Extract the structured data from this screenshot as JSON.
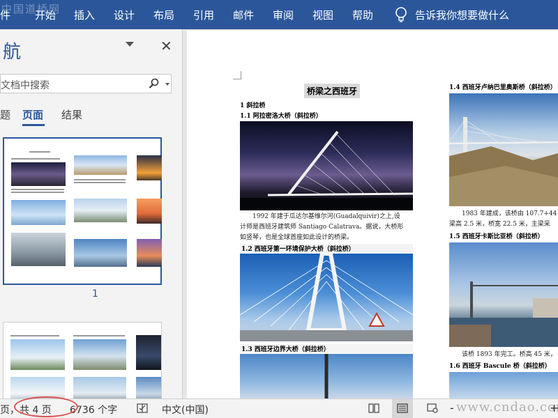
{
  "ribbon": {
    "watermark": "中国道桥网",
    "tabs": [
      "开始",
      "插入",
      "设计",
      "布局",
      "引用",
      "邮件",
      "审阅",
      "视图",
      "帮助"
    ],
    "first_tab_fragment": "件",
    "tell_me": "告诉我你想要做什么",
    "color": "#2b579a"
  },
  "nav": {
    "title": "航",
    "search_placeholder": "文档中搜索",
    "tabs": {
      "headings_fragment": "题",
      "pages": "页面",
      "results": "结果"
    },
    "thumb_page_number": "1"
  },
  "doc": {
    "title": "桥梁之西班牙",
    "section1": "1 斜拉桥",
    "h_1_1": "1.1 阿拉密洛大桥（斜拉桥）",
    "p_1_1": [
      "1992 年建于瓜达尔基维尔河(Guadalquivir)之上,设",
      "计师是西班牙建筑师 Santiago Calatrava。据说，大桥形",
      "如竖琴，也是全球首座如此设计的桥梁。"
    ],
    "h_1_2": "1.2 西班牙第一环境保护大桥（斜拉桥）",
    "h_1_3": "1.3 西班牙边界大桥（斜拉桥）",
    "h_1_4": "1.4 西班牙卢纳巴里奥斯桥（斜拉桥）",
    "p_1_4": [
      "1983 年建成，该桥由 107.7+44",
      "梁高 2.5 米，桥宽 22.5 米，主梁采"
    ],
    "h_1_5": "1.5 西班牙卡斯比亚桥（斜拉桥）",
    "p_1_5": "该桥 1893 年完工。桥高 45 米，",
    "h_1_6": "1.6 西班牙 Bascule 桥（斜拉桥）"
  },
  "status": {
    "page_info": "页，共 4 页",
    "word_count": "6736 个字",
    "language": "中文(中国)",
    "zoom_minus": "-",
    "zoom_plus": "+",
    "site_watermark": "www.cndao.com",
    "annotation_color": "#d9534f"
  }
}
